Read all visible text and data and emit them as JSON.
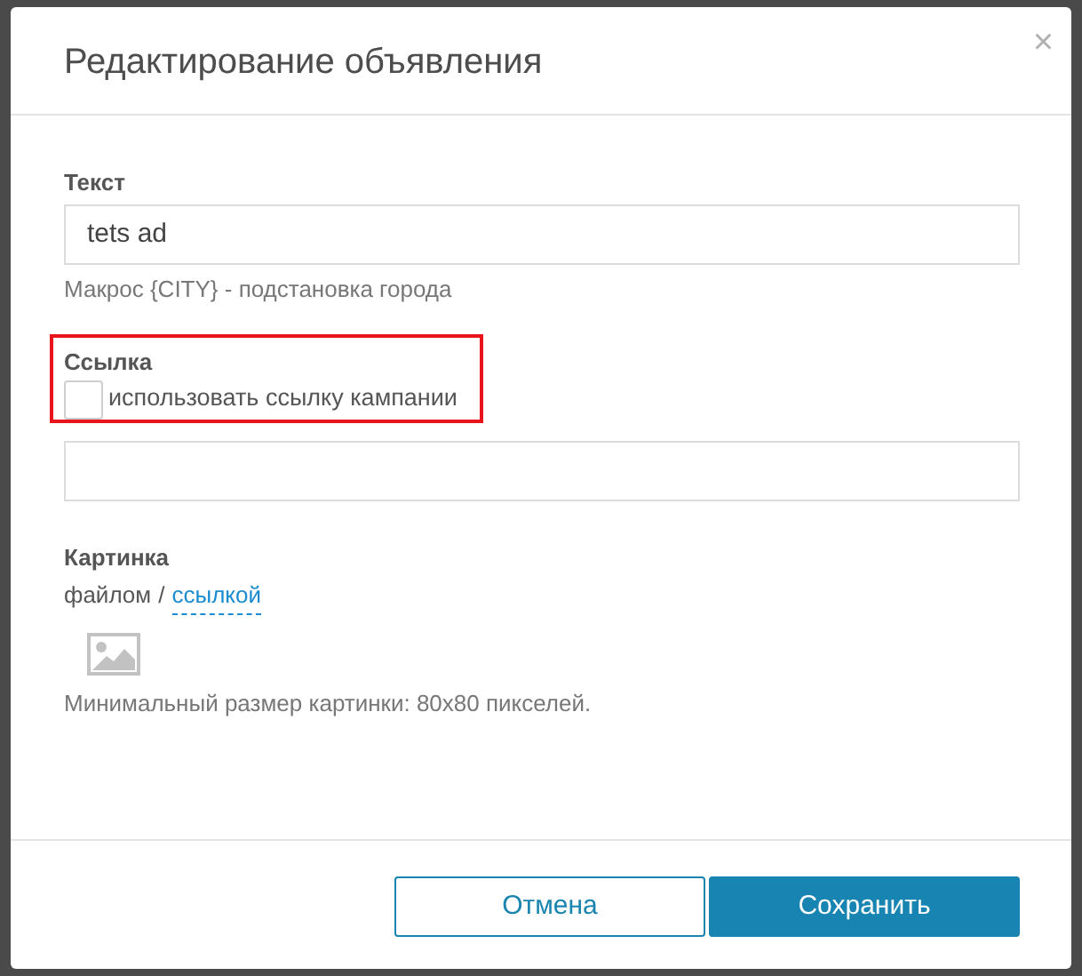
{
  "dialog": {
    "title": "Редактирование объявления",
    "close": "×"
  },
  "text_field": {
    "label": "Текст",
    "value": "tets ad",
    "hint": "Макрос {CITY} - подстановка города"
  },
  "link_field": {
    "label": "Ссылка",
    "highlighted": true,
    "checkbox": {
      "label": "использовать ссылку кампании",
      "checked": false
    }
  },
  "image_field": {
    "label": "Картинка",
    "source_file": "файлом",
    "separator": "/",
    "source_link": "ссылкой",
    "hint": "Минимальный размер картинки: 80x80 пикселей."
  },
  "buttons": [
    {
      "kind": "secondary",
      "label": "Отмена"
    },
    {
      "kind": "primary",
      "label": "Сохранить"
    }
  ]
}
